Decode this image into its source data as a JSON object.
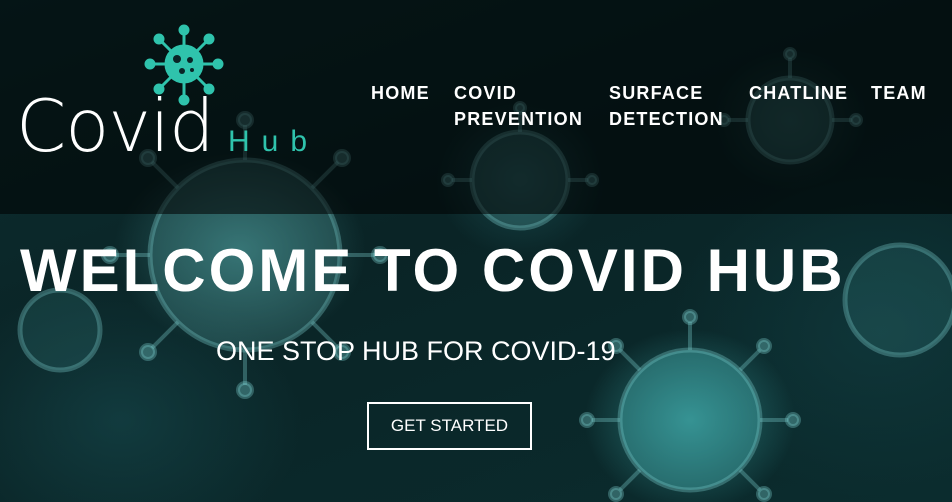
{
  "logo": {
    "word": "Covid",
    "sub": "Hub",
    "icon": "virus-icon",
    "accent_color": "#2fc3ac"
  },
  "nav": {
    "items": [
      {
        "line1": "HOME",
        "line2": ""
      },
      {
        "line1": "COVID",
        "line2": "PREVENTION"
      },
      {
        "line1": "SURFACE",
        "line2": "DETECTION"
      },
      {
        "line1": "CHATLINE",
        "line2": ""
      },
      {
        "line1": "TEAM",
        "line2": ""
      }
    ]
  },
  "hero": {
    "title": "WELCOME TO COVID HUB",
    "subtitle": "ONE STOP HUB FOR COVID-19",
    "cta_label": "GET STARTED",
    "background": "virus-background-image"
  }
}
